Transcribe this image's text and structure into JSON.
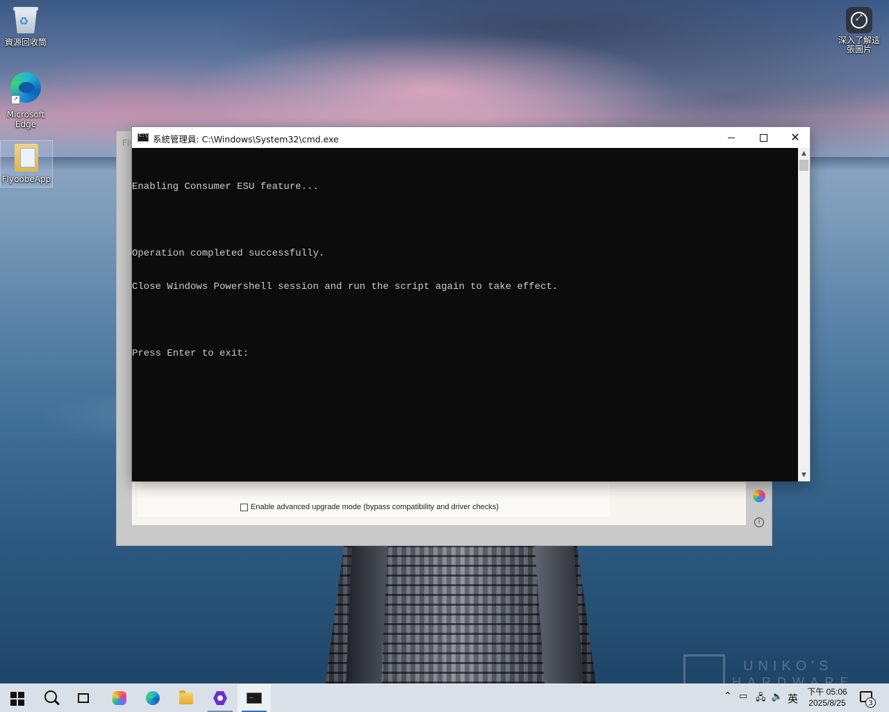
{
  "desktop": {
    "icons": [
      {
        "label": "資源回收筒",
        "icon": "recycle-bin-icon"
      },
      {
        "label": "Microsoft Edge",
        "icon": "edge-icon"
      },
      {
        "label": "FlyoobeApp",
        "icon": "folder-icon"
      }
    ],
    "spotlight": {
      "label": "深入了解這張圖片",
      "icon": "learn-about-picture-icon"
    }
  },
  "background_window": {
    "title_peek": "Fly",
    "checkbox_label": "Enable advanced upgrade mode (bypass compatibility and driver checks)",
    "checkbox_checked": false
  },
  "cmd_window": {
    "title": "系統管理員: C:\\Windows\\System32\\cmd.exe",
    "lines": [
      "Enabling Consumer ESU feature...",
      "",
      "Operation completed successfully.",
      "Close Windows Powershell session and run the script again to take effect.",
      "",
      "Press Enter to exit:"
    ]
  },
  "taskbar": {
    "apps": [
      "start-icon",
      "search-icon",
      "task-view-icon",
      "copilot-icon",
      "edge-icon",
      "file-explorer-icon",
      "app-purple-icon",
      "terminal-icon"
    ],
    "active_app": "terminal-icon",
    "tray": {
      "ime": "英",
      "time": "下午 05:06",
      "date": "2025/8/25",
      "notification_count": "3"
    }
  },
  "watermark": {
    "line1": "UNIKO'S",
    "line2": "HARDWARE"
  }
}
